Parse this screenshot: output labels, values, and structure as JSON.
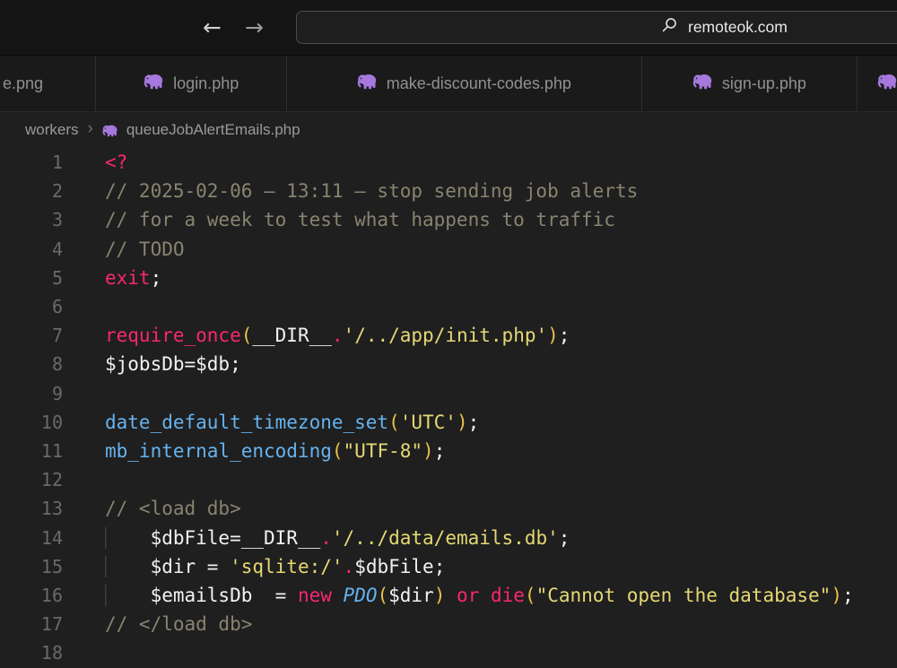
{
  "colors": {
    "php_icon": "#a678de",
    "keyword": "#f92672",
    "comment": "#88846f",
    "string": "#e6d874",
    "function": "#66b3ef",
    "bracket": "#e8c24a",
    "text": "#f2f2ef"
  },
  "titlebar": {
    "back_icon": "←",
    "forward_icon": "→",
    "url": "remoteok.com"
  },
  "tabs": [
    {
      "label": "e.png",
      "icon": false
    },
    {
      "label": "login.php",
      "icon": true
    },
    {
      "label": "make-discount-codes.php",
      "icon": true
    },
    {
      "label": "sign-up.php",
      "icon": true
    },
    {
      "label": "",
      "icon": true
    }
  ],
  "breadcrumb": {
    "folder": "workers",
    "separator": "›",
    "file": "queueJobAlertEmails.php"
  },
  "editor": {
    "lines": [
      {
        "n": 1,
        "indent": false,
        "tokens": [
          {
            "c": "k",
            "t": "<?"
          }
        ]
      },
      {
        "n": 2,
        "indent": false,
        "tokens": [
          {
            "c": "c",
            "t": "// 2025-02-06 – 13:11 – stop sending job alerts"
          }
        ]
      },
      {
        "n": 3,
        "indent": false,
        "tokens": [
          {
            "c": "c",
            "t": "// for a week to test what happens to traffic"
          }
        ]
      },
      {
        "n": 4,
        "indent": false,
        "tokens": [
          {
            "c": "c",
            "t": "// TODO"
          }
        ]
      },
      {
        "n": 5,
        "indent": false,
        "tokens": [
          {
            "c": "k",
            "t": "exit"
          },
          {
            "c": "w",
            "t": ";"
          }
        ]
      },
      {
        "n": 6,
        "indent": false,
        "tokens": []
      },
      {
        "n": 7,
        "indent": false,
        "tokens": [
          {
            "c": "k",
            "t": "require_once"
          },
          {
            "c": "b",
            "t": "("
          },
          {
            "c": "w",
            "t": "__DIR__"
          },
          {
            "c": "k",
            "t": "."
          },
          {
            "c": "s",
            "t": "'/../app/init.php'"
          },
          {
            "c": "b",
            "t": ")"
          },
          {
            "c": "w",
            "t": ";"
          }
        ]
      },
      {
        "n": 8,
        "indent": false,
        "tokens": [
          {
            "c": "w",
            "t": "$jobsDb=$db;"
          }
        ]
      },
      {
        "n": 9,
        "indent": false,
        "tokens": []
      },
      {
        "n": 10,
        "indent": false,
        "tokens": [
          {
            "c": "f",
            "t": "date_default_timezone_set"
          },
          {
            "c": "b",
            "t": "("
          },
          {
            "c": "s",
            "t": "'UTC'"
          },
          {
            "c": "b",
            "t": ")"
          },
          {
            "c": "w",
            "t": ";"
          }
        ]
      },
      {
        "n": 11,
        "indent": false,
        "tokens": [
          {
            "c": "f",
            "t": "mb_internal_encoding"
          },
          {
            "c": "b",
            "t": "("
          },
          {
            "c": "s",
            "t": "\"UTF-8\""
          },
          {
            "c": "b",
            "t": ")"
          },
          {
            "c": "w",
            "t": ";"
          }
        ]
      },
      {
        "n": 12,
        "indent": false,
        "tokens": []
      },
      {
        "n": 13,
        "indent": false,
        "tokens": [
          {
            "c": "c",
            "t": "// <load db>"
          }
        ]
      },
      {
        "n": 14,
        "indent": true,
        "tokens": [
          {
            "c": "w",
            "t": "$dbFile=__DIR__"
          },
          {
            "c": "k",
            "t": "."
          },
          {
            "c": "s",
            "t": "'/../data/emails.db'"
          },
          {
            "c": "w",
            "t": ";"
          }
        ]
      },
      {
        "n": 15,
        "indent": true,
        "tokens": [
          {
            "c": "w",
            "t": "$dir = "
          },
          {
            "c": "s",
            "t": "'sqlite:/'"
          },
          {
            "c": "k",
            "t": "."
          },
          {
            "c": "w",
            "t": "$dbFile;"
          }
        ]
      },
      {
        "n": 16,
        "indent": true,
        "tokens": [
          {
            "c": "w",
            "t": "$emailsDb  = "
          },
          {
            "c": "k",
            "t": "new"
          },
          {
            "c": "w",
            "t": " "
          },
          {
            "c": "i",
            "t": "PDO"
          },
          {
            "c": "b",
            "t": "("
          },
          {
            "c": "w",
            "t": "$dir"
          },
          {
            "c": "b",
            "t": ")"
          },
          {
            "c": "w",
            "t": " "
          },
          {
            "c": "k",
            "t": "or"
          },
          {
            "c": "w",
            "t": " "
          },
          {
            "c": "k",
            "t": "die"
          },
          {
            "c": "b",
            "t": "("
          },
          {
            "c": "s",
            "t": "\"Cannot open the database\""
          },
          {
            "c": "b",
            "t": ")"
          },
          {
            "c": "w",
            "t": ";"
          }
        ]
      },
      {
        "n": 17,
        "indent": false,
        "tokens": [
          {
            "c": "c",
            "t": "// </load db>"
          }
        ]
      },
      {
        "n": 18,
        "indent": false,
        "tokens": []
      }
    ]
  }
}
